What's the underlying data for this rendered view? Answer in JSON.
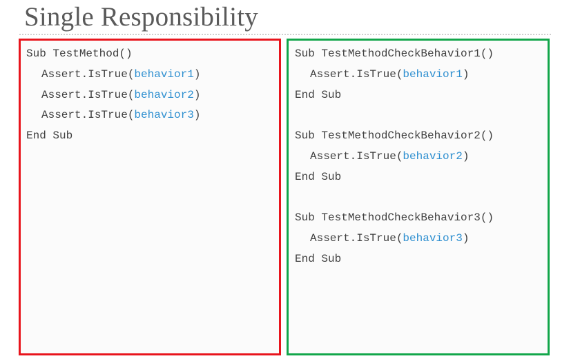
{
  "slide": {
    "title": "Single Responsibility"
  },
  "left_panel": {
    "border_color": "#e8141c",
    "lines": [
      {
        "text": "Sub TestMethod()"
      },
      {
        "prefix": "Assert.IsTrue(",
        "arg": "behavior1",
        "suffix": ")"
      },
      {
        "prefix": "Assert.IsTrue(",
        "arg": "behavior2",
        "suffix": ")"
      },
      {
        "prefix": "Assert.IsTrue(",
        "arg": "behavior3",
        "suffix": ")"
      },
      {
        "text": "End Sub"
      }
    ]
  },
  "right_panel": {
    "border_color": "#12a64a",
    "lines": [
      {
        "text": "Sub TestMethodCheckBehavior1()"
      },
      {
        "prefix": "Assert.IsTrue(",
        "arg": "behavior1",
        "suffix": ")"
      },
      {
        "text": "End Sub"
      },
      {
        "text": ""
      },
      {
        "text": "Sub TestMethodCheckBehavior2()"
      },
      {
        "prefix": "Assert.IsTrue(",
        "arg": "behavior2",
        "suffix": ")"
      },
      {
        "text": "End Sub"
      },
      {
        "text": ""
      },
      {
        "text": "Sub TestMethodCheckBehavior3()"
      },
      {
        "prefix": "Assert.IsTrue(",
        "arg": "behavior3",
        "suffix": ")"
      },
      {
        "text": "End Sub"
      }
    ]
  },
  "colors": {
    "argument": "#2e8fd0",
    "code_text": "#3f3f3f",
    "title_text": "#5a5a5a"
  }
}
